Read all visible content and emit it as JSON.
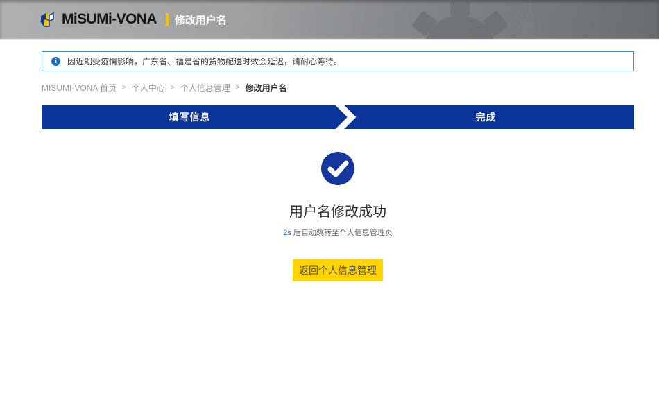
{
  "header": {
    "logo_text": "MiSUMi-VONA",
    "page_title": "修改用户名"
  },
  "notice": {
    "icon_glyph": "i",
    "text": "因近期受疫情影响，广东省、福建省的货物配送时效会延迟，请耐心等待。"
  },
  "breadcrumb": {
    "separator": ">",
    "items": [
      {
        "label": "MISUMI-VONA 首页"
      },
      {
        "label": "个人中心"
      },
      {
        "label": "个人信息管理"
      },
      {
        "label": "修改用户名"
      }
    ]
  },
  "steps": {
    "step1_label": "填写信息",
    "step2_label": "完成"
  },
  "result": {
    "title": "用户名修改成功",
    "countdown": "2s",
    "redirect_text": "后自动跳转至个人信息管理页",
    "button_label": "返回个人信息管理"
  },
  "colors": {
    "brand_navy": "#0a3499",
    "brand_yellow": "#ffd400",
    "notice_border": "#4a90d9",
    "info_icon_blue": "#1a6fc4",
    "check_circle_blue": "#16379b",
    "countdown_blue": "#2f66c9"
  }
}
